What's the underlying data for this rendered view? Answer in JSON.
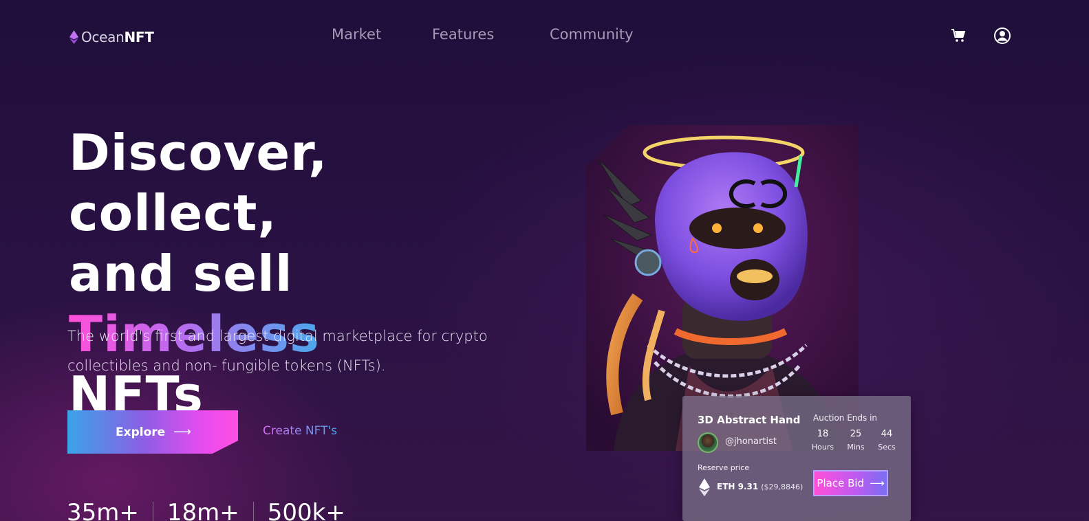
{
  "brand": {
    "name_part1": "Ocean",
    "name_part2": "NFT",
    "icon": "ethereum-gem-icon"
  },
  "nav": {
    "items": [
      {
        "label": "Market"
      },
      {
        "label": "Features"
      },
      {
        "label": "Community"
      }
    ],
    "icons": [
      "cart-icon",
      "user-account-icon"
    ]
  },
  "hero": {
    "headline_line1": "Discover, collect,",
    "headline_line2_prefix": "and sell ",
    "headline_highlight": "Timeless",
    "headline_line3": "NFTs",
    "subtitle": "The world's first and largest digital marketplace for crypto collectibles and non- fungible tokens (NFTs).",
    "explore_label": "Explore",
    "explore_arrow": "⟶",
    "create_label": "Create NFT's",
    "stats": [
      "35m+",
      "18m+",
      "500k+"
    ]
  },
  "auction": {
    "title": "3D Abstract Hand",
    "artist": "@jhonartist",
    "ends_label": "Auction Ends in",
    "countdown": [
      {
        "value": "18",
        "unit": "Hours"
      },
      {
        "value": "25",
        "unit": "Mins"
      },
      {
        "value": "44",
        "unit": "Secs"
      }
    ],
    "reserve_label": "Reserve price",
    "eth_price": "ETH 9.31",
    "usd_price": "($29,8846)",
    "bid_label": "Place Bid",
    "bid_arrow": "⟶"
  },
  "colors": {
    "background": "#1f0e3a",
    "accent_pink": "#ff4fd8",
    "accent_purple": "#b86cf0",
    "accent_blue": "#4aa8ec",
    "nav_text": "#a49ab5"
  }
}
